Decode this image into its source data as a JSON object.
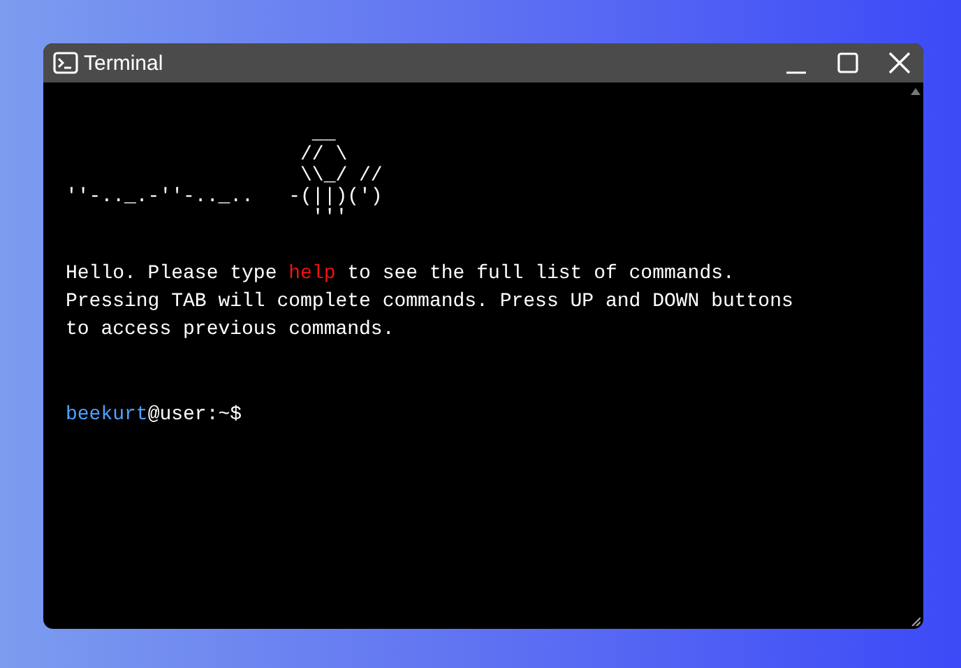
{
  "window": {
    "title": "Terminal"
  },
  "ascii_art": [
    "                     __",
    "                    // \\",
    "                    \\\\_/ //",
    "''-.._.-''-.._..   -(||)(')",
    "                     '''"
  ],
  "welcome": {
    "before": "Hello. Please type ",
    "command": "help",
    "after": " to see the full list of commands.\nPressing TAB will complete commands. Press UP and DOWN buttons\nto access previous commands."
  },
  "prompt": {
    "user": "beekurt",
    "host": "@user:~$"
  }
}
